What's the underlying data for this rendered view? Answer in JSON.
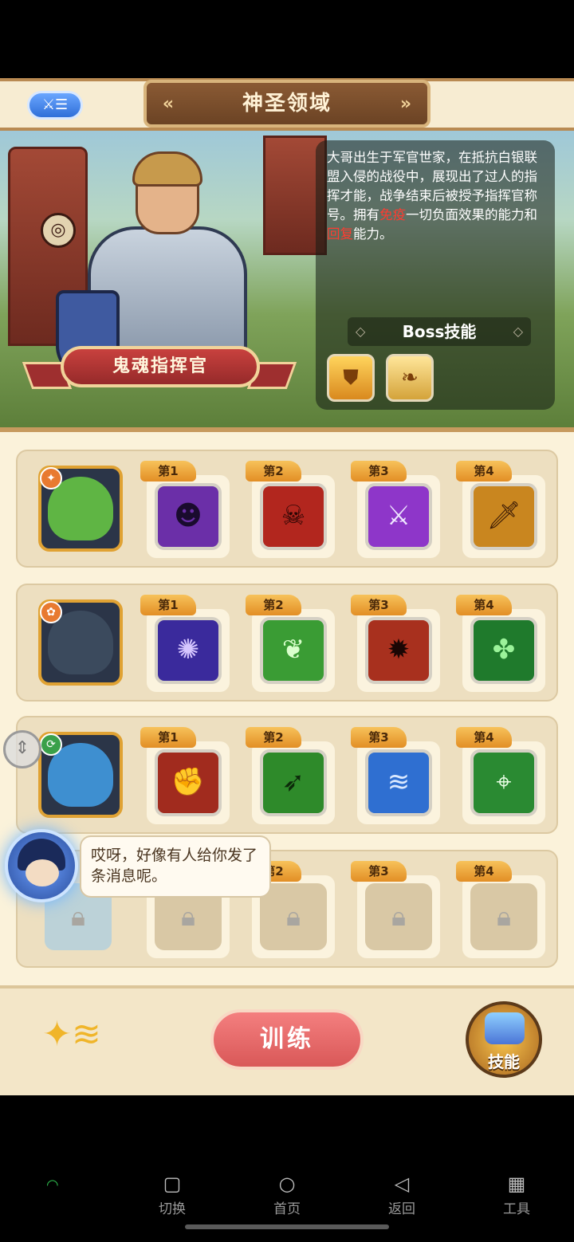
{
  "header": {
    "menu_label": "⚔☰",
    "title": "神圣领域",
    "prev_arrow": "«",
    "next_arrow": "»"
  },
  "hero": {
    "name": "鬼魂指挥官",
    "desc_part1": "大哥出生于军官世家，在抵抗白银联盟入侵的战役中，展现出了过人的指挥才能，战争结束后被授予指挥官称号。拥有",
    "desc_red1": "免疫",
    "desc_part2": "一切负面效果的能力和",
    "desc_red2": "回复",
    "desc_part3": "能力。",
    "boss_skills_title": "Boss技能"
  },
  "slot_labels": [
    "第1",
    "第2",
    "第3",
    "第4"
  ],
  "chat": {
    "message": "哎呀，好像有人给你发了条消息呢。"
  },
  "actions": {
    "train_label": "训练",
    "skill_label": "技能"
  },
  "system_nav": {
    "switch": "切换",
    "home": "首页",
    "back": "返回",
    "tools": "工具"
  },
  "colors": {
    "accent_red": "#d95858",
    "tag_orange": "#e28e25",
    "parchment": "#fbf2da"
  }
}
